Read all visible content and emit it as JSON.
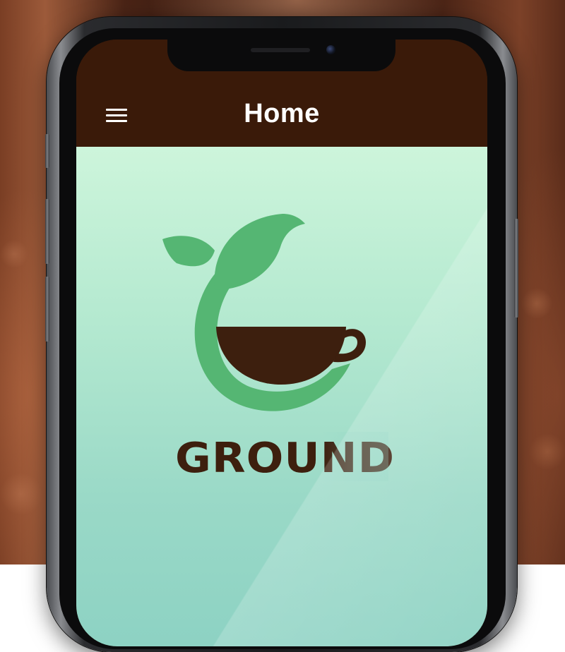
{
  "header": {
    "title": "Home",
    "menu_icon": "hamburger-menu-icon"
  },
  "brand": {
    "name": "GROUND",
    "logo_icon": "leaf-coffee-cup-logo"
  },
  "colors": {
    "header_bg": "#3a1a09",
    "content_bg_top": "#cdf5db",
    "content_bg_bottom": "#8dd2c3",
    "leaf_green": "#55b673",
    "coffee_brown": "#3d1f0e",
    "title_text": "#ffffff"
  }
}
